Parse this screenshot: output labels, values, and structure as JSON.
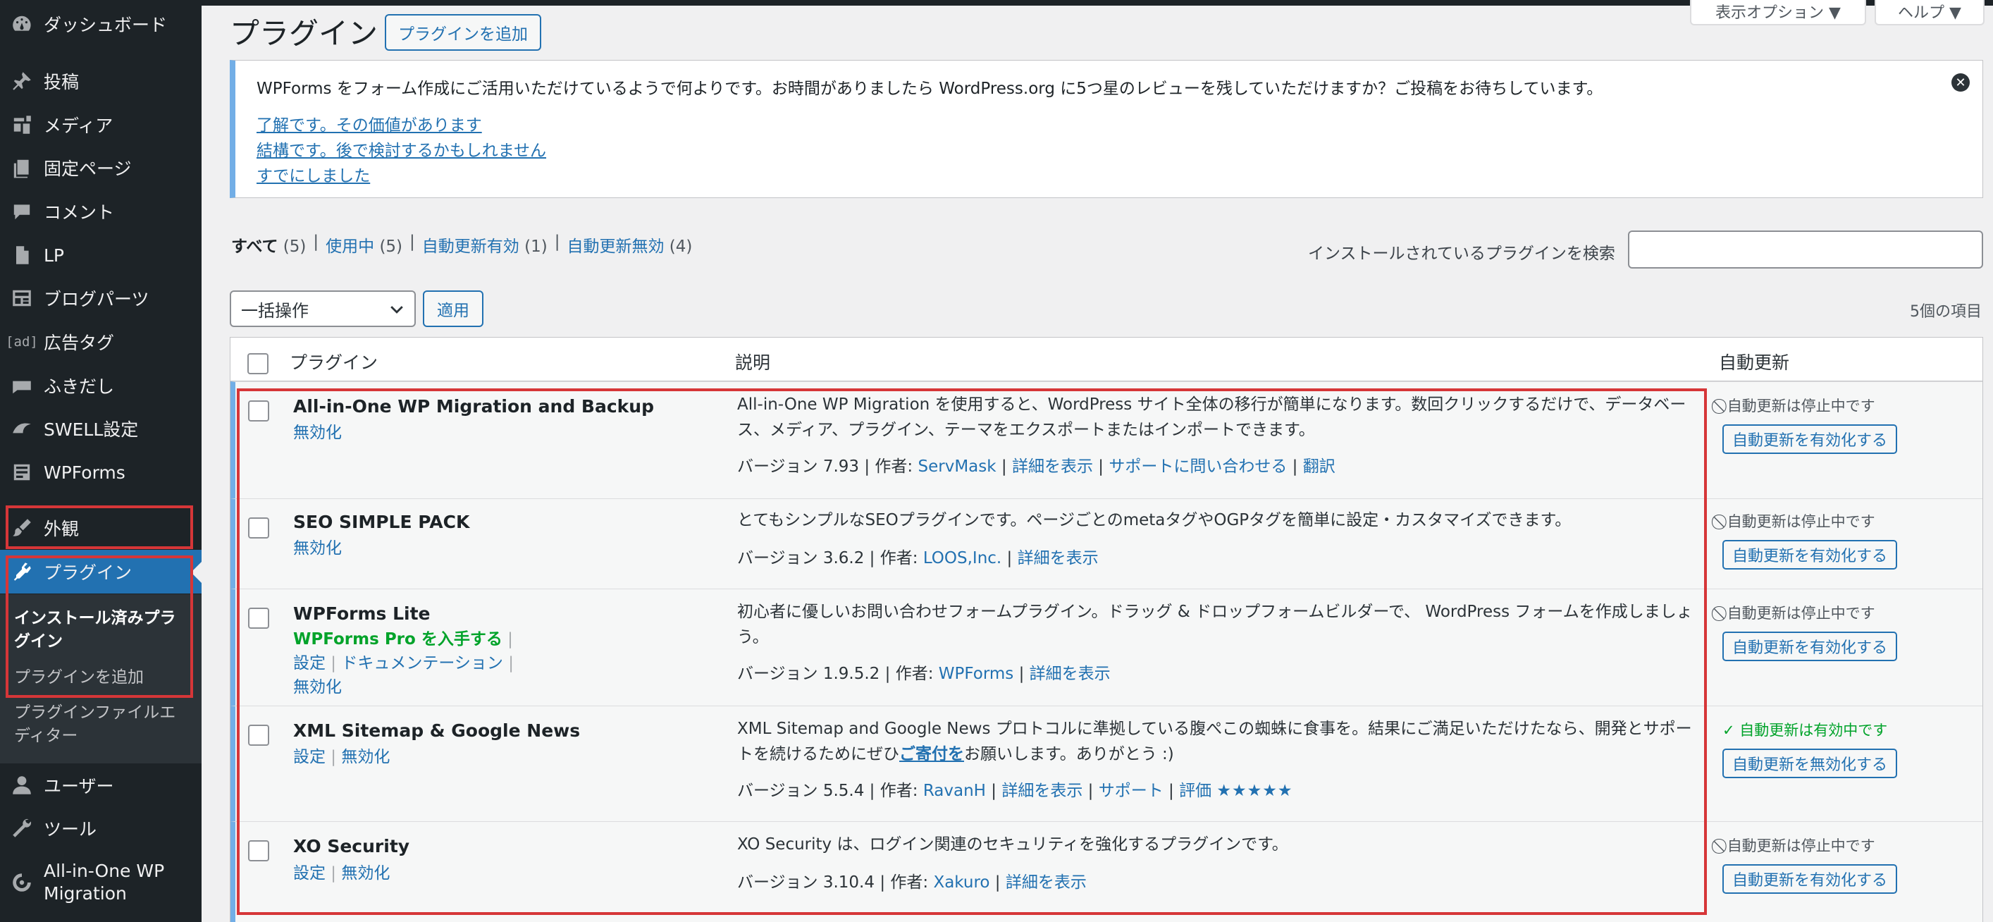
{
  "sidebar": {
    "items": [
      {
        "label": "ダッシュボード",
        "icon": "dashboard-icon"
      },
      {
        "label": "投稿",
        "icon": "pin-icon"
      },
      {
        "label": "メディア",
        "icon": "media-icon"
      },
      {
        "label": "固定ページ",
        "icon": "page-icon"
      },
      {
        "label": "コメント",
        "icon": "comment-icon"
      },
      {
        "label": "LP",
        "icon": "document-icon"
      },
      {
        "label": "ブログパーツ",
        "icon": "layout-icon"
      },
      {
        "label": "広告タグ",
        "icon": "ad-icon",
        "icon_text": "[ad]"
      },
      {
        "label": "ふきだし",
        "icon": "speech-bubble-icon"
      },
      {
        "label": "SWELL設定",
        "icon": "swell-icon"
      },
      {
        "label": "WPForms",
        "icon": "form-icon"
      },
      {
        "label": "外観",
        "icon": "brush-icon"
      },
      {
        "label": "プラグイン",
        "icon": "plugin-icon"
      },
      {
        "label": "ユーザー",
        "icon": "user-icon"
      },
      {
        "label": "ツール",
        "icon": "wrench-icon"
      },
      {
        "label": "All-in-One WP Migration",
        "icon": "migration-icon"
      }
    ],
    "submenu": [
      {
        "label": "インストール済みプラグイン"
      },
      {
        "label": "プラグインを追加"
      },
      {
        "label": "プラグインファイルエディター"
      }
    ]
  },
  "header": {
    "title": "プラグイン",
    "add_button": "プラグインを追加",
    "screen_options": "表示オプション ▼",
    "help": "ヘルプ ▼"
  },
  "notice": {
    "message": "WPForms をフォーム作成にご活用いただけているようで何よりです。お時間がありましたら WordPress.org に5つ星のレビューを残していただけますか？ご投稿をお待ちしています。",
    "links": [
      "了解です。その価値があります",
      "結構です。後で検討するかもしれません",
      "すでにしました"
    ],
    "close": "✕"
  },
  "filters": {
    "all": "すべて",
    "all_count": "(5)",
    "active": "使用中",
    "active_count": "(5)",
    "auto_on": "自動更新有効",
    "auto_on_count": "(1)",
    "auto_off": "自動更新無効",
    "auto_off_count": "(4)",
    "sep": "|"
  },
  "search": {
    "label": "インストールされているプラグインを検索",
    "value": ""
  },
  "bulk": {
    "selected": "一括操作",
    "apply": "適用",
    "items_count": "5個の項目"
  },
  "table": {
    "columns": {
      "plugin": "プラグイン",
      "description": "説明",
      "auto_update": "自動更新"
    },
    "rows": [
      {
        "name": "All-in-One WP Migration and Backup",
        "actions": [
          "無効化"
        ],
        "description": "All-in-One WP Migration を使用すると、WordPress サイト全体の移行が簡単になります。数回クリックするだけで、データベース、メディア、プラグイン、テーマをエクスポートまたはインポートできます。",
        "version": "バージョン 7.93 | 作者: ",
        "author": "ServMask",
        "links": [
          "詳細を表示",
          "サポートに問い合わせる",
          "翻訳"
        ],
        "auto_status": "自動更新は停止中です",
        "auto_button": "自動更新を有効化する"
      },
      {
        "name": "SEO SIMPLE PACK",
        "actions": [
          "無効化"
        ],
        "description": "とてもシンプルなSEOプラグインです。ページごとのmetaタグやOGPタグを簡単に設定・カスタマイズできます。",
        "version": "バージョン 3.6.2 | 作者: ",
        "author": "LOOS,Inc.",
        "links": [
          "詳細を表示"
        ],
        "auto_status": "自動更新は停止中です",
        "auto_button": "自動更新を有効化する"
      },
      {
        "name": "WPForms Lite",
        "actions_pro": "WPForms Pro を入手する",
        "actions_settings": "設定",
        "actions_docs": "ドキュメンテーション",
        "actions_deactivate": "無効化",
        "description": "初心者に優しいお問い合わせフォームプラグイン。ドラッグ & ドロップフォームビルダーで、 WordPress フォームを作成しましょう。",
        "version": "バージョン 1.9.5.2 | 作者: ",
        "author": "WPForms",
        "links": [
          "詳細を表示"
        ],
        "auto_status": "自動更新は停止中です",
        "auto_button": "自動更新を有効化する"
      },
      {
        "name": "XML Sitemap & Google News",
        "actions": [
          "設定",
          "無効化"
        ],
        "description_pre": "XML Sitemap and Google News プロトコルに準拠している腹ぺこの蜘蛛に食事を。結果にご満足いただけたなら、開発とサポートを続けるためにぜひ",
        "description_link": "ご寄付を",
        "description_post": "お願いします。ありがとう :)",
        "version": "バージョン 5.5.4 | 作者: ",
        "author": "RavanH",
        "links": [
          "詳細を表示",
          "サポート",
          "評価"
        ],
        "stars": "★★★★★",
        "auto_status": "自動更新は有効中です",
        "auto_button": "自動更新を無効化する"
      },
      {
        "name": "XO Security",
        "actions": [
          "設定",
          "無効化"
        ],
        "description": "XO Security は、ログイン関連のセキュリティを強化するプラグインです。",
        "version": "バージョン 3.10.4 | 作者: ",
        "author": "Xakuro",
        "links": [
          "詳細を表示"
        ],
        "auto_status": "自動更新は停止中です",
        "auto_button": "自動更新を有効化する"
      }
    ]
  },
  "status_icons": {
    "disabled": "⃠",
    "enabled": "✓"
  },
  "colors": {
    "accent": "#2271b1",
    "highlight": "#d63638",
    "sidebar": "#1d2327",
    "success": "#00a32a"
  }
}
